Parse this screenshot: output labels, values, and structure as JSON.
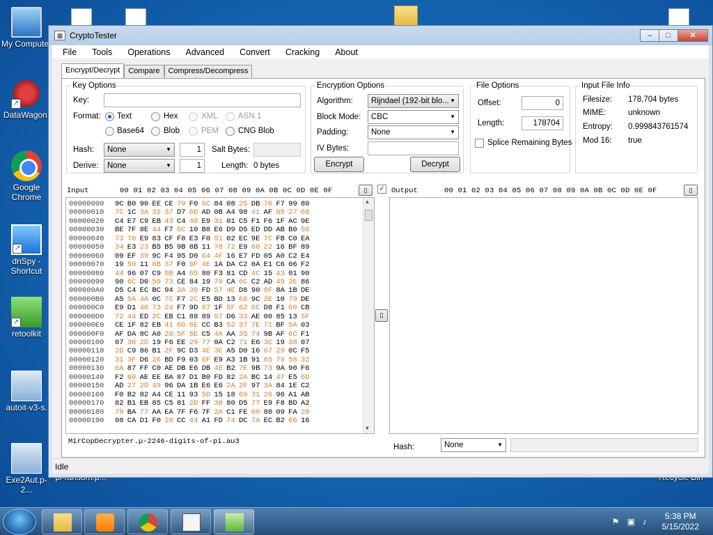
{
  "desktop": {
    "icons": [
      {
        "label": "My Computer",
        "icon": "computer-icon"
      },
      {
        "label": "DataWagon.",
        "icon": "web-icon"
      },
      {
        "label": "Google Chrome",
        "icon": "chrome-icon"
      },
      {
        "label": "dnSpy - Shortcut",
        "icon": "dnspy-icon"
      },
      {
        "label": "retoolkit",
        "icon": "retoolkit-icon"
      },
      {
        "label": "autoit-v3-s.",
        "icon": "autoit-icon"
      },
      {
        "label": "Exe2Aut.p-2...",
        "icon": "exe2aut-icon"
      },
      {
        "label": "pi-ransom.p...",
        "icon": "document-icon"
      },
      {
        "label": "Recycle Bin",
        "icon": "recycle-bin-icon"
      }
    ]
  },
  "window": {
    "title": "CryptoTester",
    "controls": {
      "minimize": "–",
      "maximize": "□",
      "close": "✕"
    },
    "menu": [
      "File",
      "Tools",
      "Operations",
      "Advanced",
      "Convert",
      "Cracking",
      "About"
    ],
    "tabs": [
      "Encrypt/Decrypt",
      "Compare",
      "Compress/Decompress"
    ],
    "key_options": {
      "legend": "Key Options",
      "key_label": "Key:",
      "key_value": "",
      "format_label": "Format:",
      "formats": [
        {
          "label": "Text",
          "selected": true,
          "enabled": true
        },
        {
          "label": "Hex",
          "selected": false,
          "enabled": true
        },
        {
          "label": "XML",
          "selected": false,
          "enabled": false
        },
        {
          "label": "ASN.1",
          "selected": false,
          "enabled": false
        },
        {
          "label": "Base64",
          "selected": false,
          "enabled": true
        },
        {
          "label": "Blob",
          "selected": false,
          "enabled": true
        },
        {
          "label": "PEM",
          "selected": false,
          "enabled": false
        },
        {
          "label": "CNG Blob",
          "selected": false,
          "enabled": true
        }
      ],
      "hash_label": "Hash:",
      "hash_value": "None",
      "hash_count": "1",
      "salt_label": "Salt Bytes:",
      "derive_label": "Derive:",
      "derive_value": "None",
      "derive_count": "1",
      "length_label": "Length:",
      "length_value": "0 bytes"
    },
    "encryption_options": {
      "legend": "Encryption Options",
      "algorithm_label": "Algorithm:",
      "algorithm_value": "Rijndael (192-bit blo...",
      "blockmode_label": "Block Mode:",
      "blockmode_value": "CBC",
      "padding_label": "Padding:",
      "padding_value": "None",
      "iv_label": "IV Bytes:",
      "encrypt_label": "Encrypt",
      "decrypt_label": "Decrypt"
    },
    "file_options": {
      "legend": "File Options",
      "offset_label": "Offset:",
      "offset_value": "0",
      "length_label": "Length:",
      "length_value": "178704",
      "splice_label": "Splice Remaining Bytes",
      "splice_checked": false
    },
    "input_file_info": {
      "legend": "Input File Info",
      "filesize_label": "Filesize:",
      "filesize_value": "178,704 bytes",
      "mime_label": "MIME:",
      "mime_value": "unknown",
      "entropy_label": "Entropy:",
      "entropy_value": "0.999843761574",
      "mod16_label": "Mod 16:",
      "mod16_value": "true"
    },
    "input": {
      "label": "Input",
      "header": "00 01 02 03 04 05 06 07 08 09 0A 0B 0C 0D 0E 0F",
      "filename": "MirCopDecrypter.µ-2246-digits-of-pi.au3",
      "rows": [
        {
          "off": "00000000",
          "bytes": "9C B0 90 EE CE 79 F0 6C 84 08 25 DB 70 F7 99 80"
        },
        {
          "off": "00000010",
          "bytes": "7C 1C 3A 32 37 D7 6D AD 0B A4 98 41 AF 65 27 68"
        },
        {
          "off": "00000020",
          "bytes": "C4 E7 C9 EB 43 C4 40 E9 31 01 C5 F1 F6 1F AC 9E"
        },
        {
          "off": "00000030",
          "bytes": "BE 7F 8E 44 F7 6C 10 B8 E6 D9 D5 ED DD AB B0 50"
        },
        {
          "off": "00000040",
          "bytes": "73 78 E9 83 CF F8 E3 F0 51 02 EC 9E 7C FB C0 EA"
        },
        {
          "off": "00000050",
          "bytes": "34 E3 23 B5 B5 9B 8B 11 78 72 E9 60 22 16 BF 89"
        },
        {
          "off": "00000060",
          "bytes": "09 EF 39 9C F4 95 D0 64 4F 16 E7 FD 05 A0 C2 E4"
        },
        {
          "off": "00000070",
          "bytes": "19 50 11 6B 37 F0 6F 4E 1A DA C2 0A E1 C6 06 F2"
        },
        {
          "off": "00000080",
          "bytes": "44 96 07 C9 5B A4 65 80 F3 81 CD 4C 15 43 01 90"
        },
        {
          "off": "00000090",
          "bytes": "90 6C D0 50 73 CE 84 19 70 CA 6C C2 AD 49 3E 86"
        },
        {
          "off": "000000A0",
          "bytes": "D5 C4 EC BC 94 2A 30 FD 57 4E D8 90 6F 8A 1B DE"
        },
        {
          "off": "000000B0",
          "bytes": "A5 5A 4A 0C 7C F7 2C E5 BD 13 68 9C 2E 10 79 DE"
        },
        {
          "off": "000000C0",
          "bytes": "E9 D1 46 73 24 F7 9D 67 1F 5F 62 6C D8 F1 60 CB"
        },
        {
          "off": "000000D0",
          "bytes": "72 44 ED 2C EB C1 88 89 57 D6 33 AE 00 85 13 5F"
        },
        {
          "off": "000000E0",
          "bytes": "CE 1F 82 EB 41 60 6E CC B3 52 37 7E 71 BF 5A 03"
        },
        {
          "off": "000000F0",
          "bytes": "AF DA 8C A0 28 5F 5E C5 4A AA 35 74 9B AF 6C F1"
        },
        {
          "off": "00000100",
          "bytes": "07 36 2D 19 F6 EE 29 77 0A C2 71 E6 3C 19 38 07"
        },
        {
          "off": "00000110",
          "bytes": "2D C9 86 B1 2F 9C D3 4E 3E A5 D0 16 67 29 0C F5"
        },
        {
          "off": "00000120",
          "bytes": "31 3F D6 26 BD F9 03 6F E9 A3 1B 91 65 79 58 32"
        },
        {
          "off": "00000130",
          "bytes": "6A 87 FF C0 AE DB E6 DB 4E B2 7E 9B 73 9A 90 F6"
        },
        {
          "off": "00000140",
          "bytes": "F2 60 AE EE BA 87 D1 B0 FD 82 2A BC 14 47 E5 6D"
        },
        {
          "off": "00000150",
          "bytes": "AD 27 2D 49 96 DA 1B E6 E6 2A 2F 97 3A 84 1E C2"
        },
        {
          "off": "00000160",
          "bytes": "F0 B2 82 A4 CE 11 93 5D 15 18 69 31 26 96 A1 AB"
        },
        {
          "off": "00000170",
          "bytes": "82 B1 EB 85 C5 81 2D FF 38 80 D5 77 E9 F8 BD A2"
        },
        {
          "off": "00000180",
          "bytes": "79 BA 77 AA EA 7F F6 7F 2A C1 FE 60 80 09 FA 28"
        },
        {
          "off": "00000190",
          "bytes": "08 CA D1 F0 28 CC 44 A1 FD 74 DC 7A EC B2 66 16"
        }
      ]
    },
    "output": {
      "label": "Output",
      "header": "00 01 02 03 04 05 06 07 08 09 0A 0B 0C 0D 0E 0F",
      "checked": true,
      "hash_label": "Hash:",
      "hash_value": "None"
    },
    "status": "Idle"
  },
  "taskbar": {
    "buttons": [
      "explorer-icon",
      "media-player-icon",
      "chrome-icon",
      "clipboard-icon",
      "notepad-icon"
    ],
    "time": "5:38 PM",
    "date": "5/15/2022"
  }
}
